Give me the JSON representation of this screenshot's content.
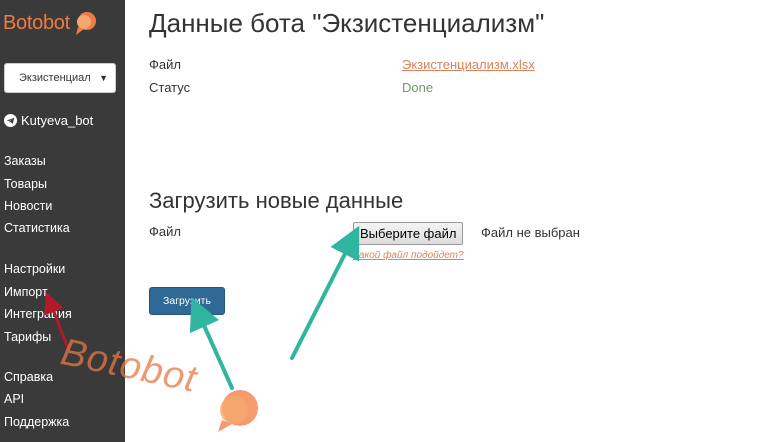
{
  "sidebar": {
    "logo_text": "Botobot",
    "bot_select_value": "Экзистенциал",
    "bot_name": "Kutyeva_bot",
    "nav_group1": [
      "Заказы",
      "Товары",
      "Новости",
      "Статистика"
    ],
    "nav_group2": [
      "Настройки",
      "Импорт",
      "Интеграция",
      "Тарифы"
    ],
    "nav_group3": [
      "Справка",
      "API",
      "Поддержка"
    ]
  },
  "main": {
    "title": "Данные бота \"Экзистенциализм\"",
    "file_label": "Файл",
    "file_link": "Экзистенциализм.xlsx",
    "status_label": "Статус",
    "status_value": "Done",
    "upload_section_title": "Загрузить новые данные",
    "upload_file_label": "Файл",
    "choose_file_button": "Выберите файл",
    "no_file_text": "Файл не выбран",
    "help_link": "Какой файл подойдет?",
    "upload_button": "Загрузить"
  },
  "overlay": {
    "watermark_text": "Botobot"
  },
  "colors": {
    "sidebar_bg": "#3a3a3a",
    "accent_orange": "#f07a3f",
    "link_orange": "#d9825b",
    "status_green": "#6f9a6a",
    "primary_button": "#2f6a97",
    "annotation_arrow": "#2fb5a0",
    "annotation_red": "#b21a2a"
  }
}
